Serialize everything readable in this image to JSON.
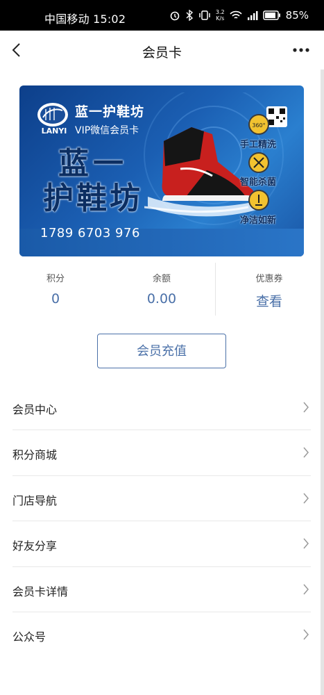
{
  "status_bar": {
    "carrier_time": "中国移动 15:02",
    "net_speed_value": "3.2",
    "net_speed_unit": "K/s",
    "battery": "85%"
  },
  "nav": {
    "title": "会员卡"
  },
  "card": {
    "brand": "蓝一护鞋坊",
    "vip_label": "VIP微信会员卡",
    "big_line1": "蓝一",
    "big_line2": "护鞋坊",
    "card_number": "1789 6703 976",
    "logo_text": "LANYI",
    "features": [
      "手工精洗",
      "智能杀菌",
      "净洁如新"
    ],
    "feature_badge": "360°"
  },
  "stats": {
    "points_label": "积分",
    "points_value": "0",
    "balance_label": "余额",
    "balance_value": "0.00",
    "coupon_label": "优惠券",
    "coupon_value": "查看"
  },
  "recharge_label": "会员充值",
  "menu": [
    {
      "label": "会员中心"
    },
    {
      "label": "积分商城"
    },
    {
      "label": "门店导航"
    },
    {
      "label": "好友分享"
    },
    {
      "label": "会员卡详情"
    },
    {
      "label": "公众号"
    }
  ],
  "colors": {
    "accent": "#4a70a8",
    "card_blue": "#1b5fb3"
  }
}
